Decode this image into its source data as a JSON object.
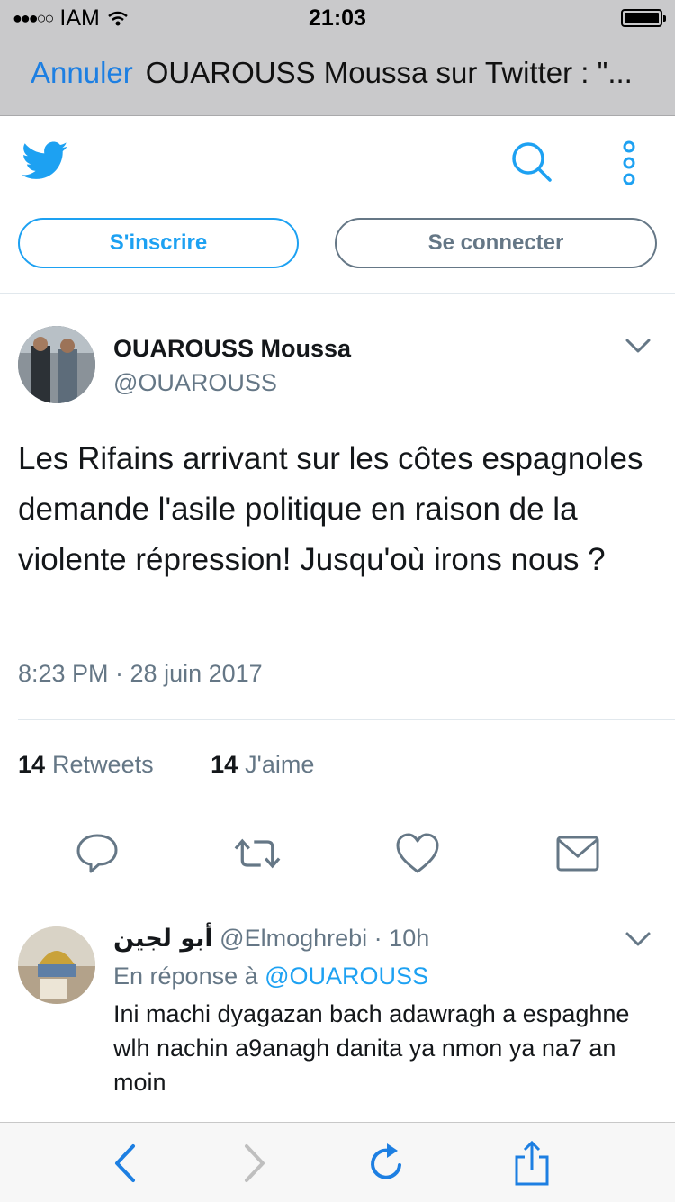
{
  "status_bar": {
    "carrier": "IAM",
    "time": "21:03"
  },
  "nav": {
    "cancel_label": "Annuler",
    "title": "OUAROUSS Moussa sur Twitter : \"..."
  },
  "header": {
    "signup_label": "S'inscrire",
    "login_label": "Se connecter"
  },
  "tweet": {
    "author_name": "OUAROUSS Moussa",
    "author_handle": "@OUAROUSS",
    "text": "Les Rifains arrivant sur les côtes espagnoles demande l'asile politique en raison de la violente répression! Jusqu'où irons  nous ?",
    "datetime": "8:23 PM · 28 juin 2017",
    "retweets_count": "14",
    "retweets_label": "Retweets",
    "likes_count": "14",
    "likes_label": "J'aime"
  },
  "reply": {
    "author_name": "أبو لجين",
    "author_handle": "@Elmoghrebi",
    "separator": "·",
    "time": "10h",
    "in_reply_prefix": "En réponse à",
    "in_reply_mention": "@OUAROUSS",
    "text": "Ini machi dyagazan bach adawragh a espaghne wlh nachin a9anagh danita ya nmon ya na7 an moin"
  },
  "colors": {
    "twitter_blue": "#1da1f2",
    "ios_blue": "#1d7fe2",
    "secondary_gray": "#657786"
  },
  "icons": [
    "twitter-bird-icon",
    "search-icon",
    "more-vertical-icon",
    "chevron-down-icon",
    "reply-icon",
    "retweet-icon",
    "like-icon",
    "direct-message-icon",
    "back-icon",
    "forward-icon",
    "reload-icon",
    "share-icon",
    "wifi-icon",
    "battery-icon"
  ]
}
